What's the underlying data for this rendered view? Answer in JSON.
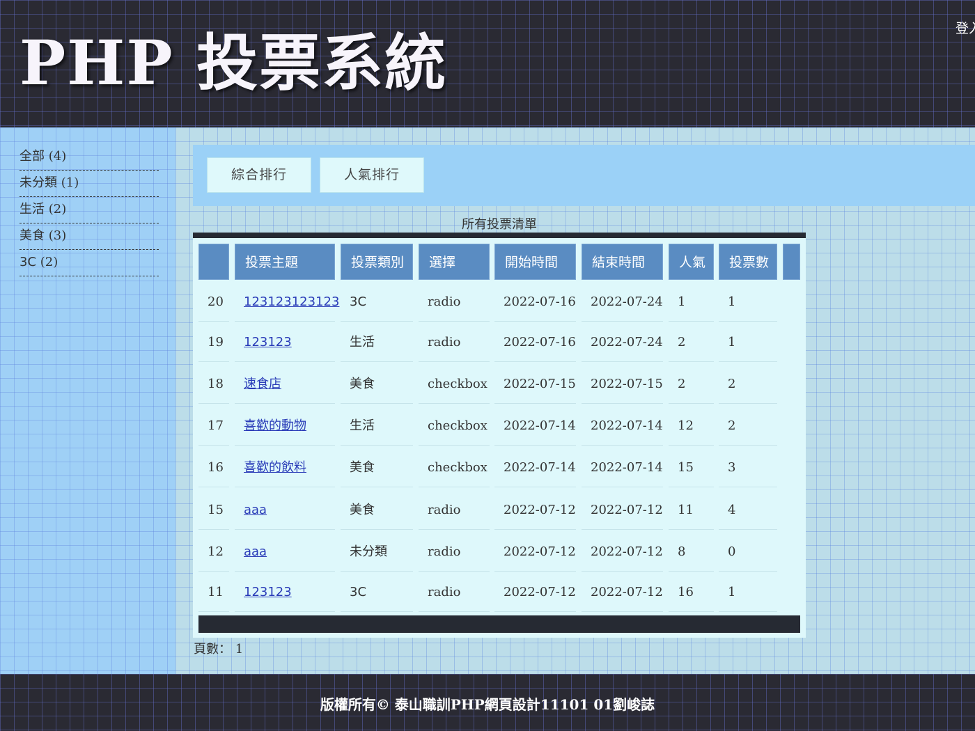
{
  "header": {
    "title": "PHP 投票系統",
    "login_label": "登入"
  },
  "sidebar": {
    "items": [
      {
        "label": "全部",
        "count": "(4)"
      },
      {
        "label": "未分類",
        "count": "(1)"
      },
      {
        "label": "生活",
        "count": "(2)"
      },
      {
        "label": "美食",
        "count": "(3)"
      },
      {
        "label": "3C",
        "count": "(2)"
      }
    ]
  },
  "tabs": {
    "overall": "綜合排行",
    "popular": "人氣排行"
  },
  "list": {
    "caption": "所有投票清單",
    "headers": [
      "",
      "投票主題",
      "投票類別",
      "選擇",
      "開始時間",
      "結束時間",
      "人氣",
      "投票數",
      ""
    ],
    "rows": [
      {
        "id": "20",
        "topic": "123123123123",
        "category": "3C",
        "type": "radio",
        "start": "2022-07-16",
        "end": "2022-07-24",
        "views": "1",
        "votes": "1"
      },
      {
        "id": "19",
        "topic": "123123",
        "category": "生活",
        "type": "radio",
        "start": "2022-07-16",
        "end": "2022-07-24",
        "views": "2",
        "votes": "1"
      },
      {
        "id": "18",
        "topic": "速食店",
        "category": "美食",
        "type": "checkbox",
        "start": "2022-07-15",
        "end": "2022-07-15",
        "views": "2",
        "votes": "2"
      },
      {
        "id": "17",
        "topic": "喜歡的動物",
        "category": "生活",
        "type": "checkbox",
        "start": "2022-07-14",
        "end": "2022-07-14",
        "views": "12",
        "votes": "2"
      },
      {
        "id": "16",
        "topic": "喜歡的飲料",
        "category": "美食",
        "type": "checkbox",
        "start": "2022-07-14",
        "end": "2022-07-14",
        "views": "15",
        "votes": "3"
      },
      {
        "id": "15",
        "topic": "aaa",
        "category": "美食",
        "type": "radio",
        "start": "2022-07-12",
        "end": "2022-07-12",
        "views": "11",
        "votes": "4"
      },
      {
        "id": "12",
        "topic": "aaa",
        "category": "未分類",
        "type": "radio",
        "start": "2022-07-12",
        "end": "2022-07-12",
        "views": "8",
        "votes": "0"
      },
      {
        "id": "11",
        "topic": "123123",
        "category": "3C",
        "type": "radio",
        "start": "2022-07-12",
        "end": "2022-07-12",
        "views": "16",
        "votes": "1"
      }
    ]
  },
  "pager": {
    "label": "頁數：",
    "pages": [
      "1"
    ]
  },
  "footer": {
    "text": "版權所有© 泰山職訓PHP網頁設計11101 01劉峻誌"
  }
}
